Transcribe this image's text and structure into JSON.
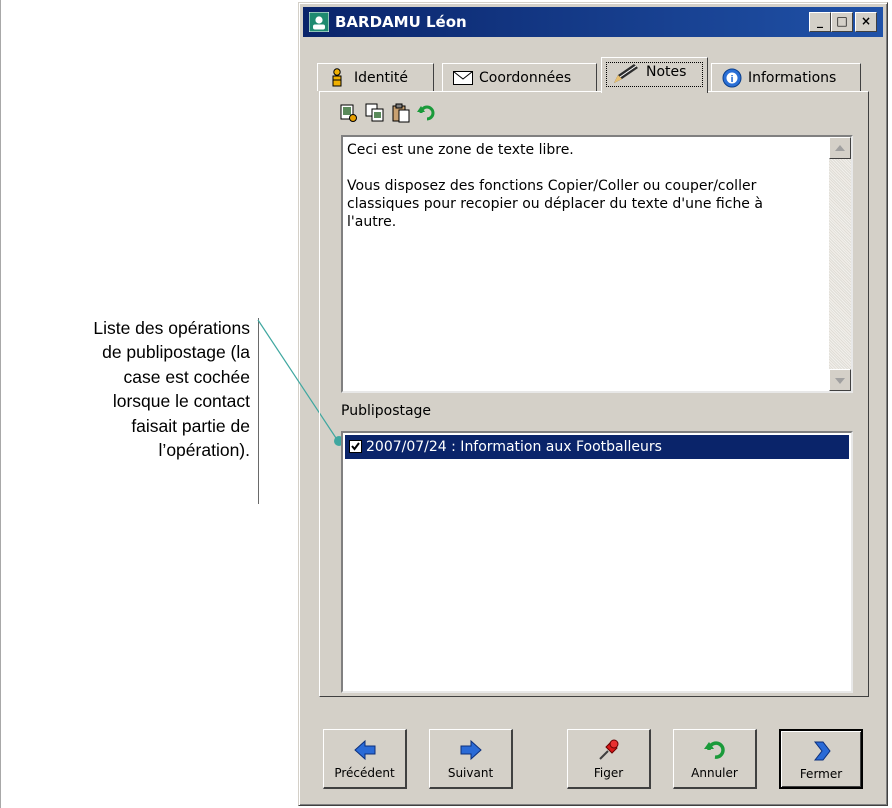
{
  "annotation": {
    "lines": [
      "Liste des opérations",
      "de publipostage (la",
      "case est cochée",
      "lorsque le contact",
      "faisait partie de",
      "l’opération)."
    ]
  },
  "window": {
    "title": "BARDAMU Léon",
    "controls": {
      "minimize": "_",
      "maximize": "□",
      "close": "×"
    }
  },
  "tabs": [
    {
      "label": "Identité",
      "icon": "person-icon",
      "active": false
    },
    {
      "label": "Coordonnées",
      "icon": "envelope-icon",
      "active": false
    },
    {
      "label": "Notes",
      "icon": "pencil-icon",
      "active": true
    },
    {
      "label": "Informations",
      "icon": "info-icon",
      "active": false
    }
  ],
  "toolbar": {
    "icons": [
      "cut-icon",
      "copy-icon",
      "paste-icon",
      "undo-icon"
    ]
  },
  "notes": {
    "line1": "Ceci est une zone de texte libre.",
    "line2": "Vous disposez des fonctions Copier/Coller ou couper/coller classiques pour recopier ou déplacer du texte d'une fiche à l'autre."
  },
  "publipostage": {
    "label": "Publipostage",
    "items": [
      {
        "text": "2007/07/24 : Information aux Footballeurs",
        "checked": true,
        "selected": true
      }
    ]
  },
  "buttons": [
    {
      "label": "Précédent",
      "icon": "arrow-left-icon"
    },
    {
      "label": "Suivant",
      "icon": "arrow-right-icon"
    },
    {
      "label": "Figer",
      "icon": "pushpin-icon"
    },
    {
      "label": "Annuler",
      "icon": "undo-icon"
    },
    {
      "label": "Fermer",
      "icon": "chevron-right-icon"
    }
  ],
  "colors": {
    "titlebar": "#0a246a",
    "selection": "#0a246a",
    "face": "#d4d0c8",
    "callout": "#3fa7a0"
  }
}
